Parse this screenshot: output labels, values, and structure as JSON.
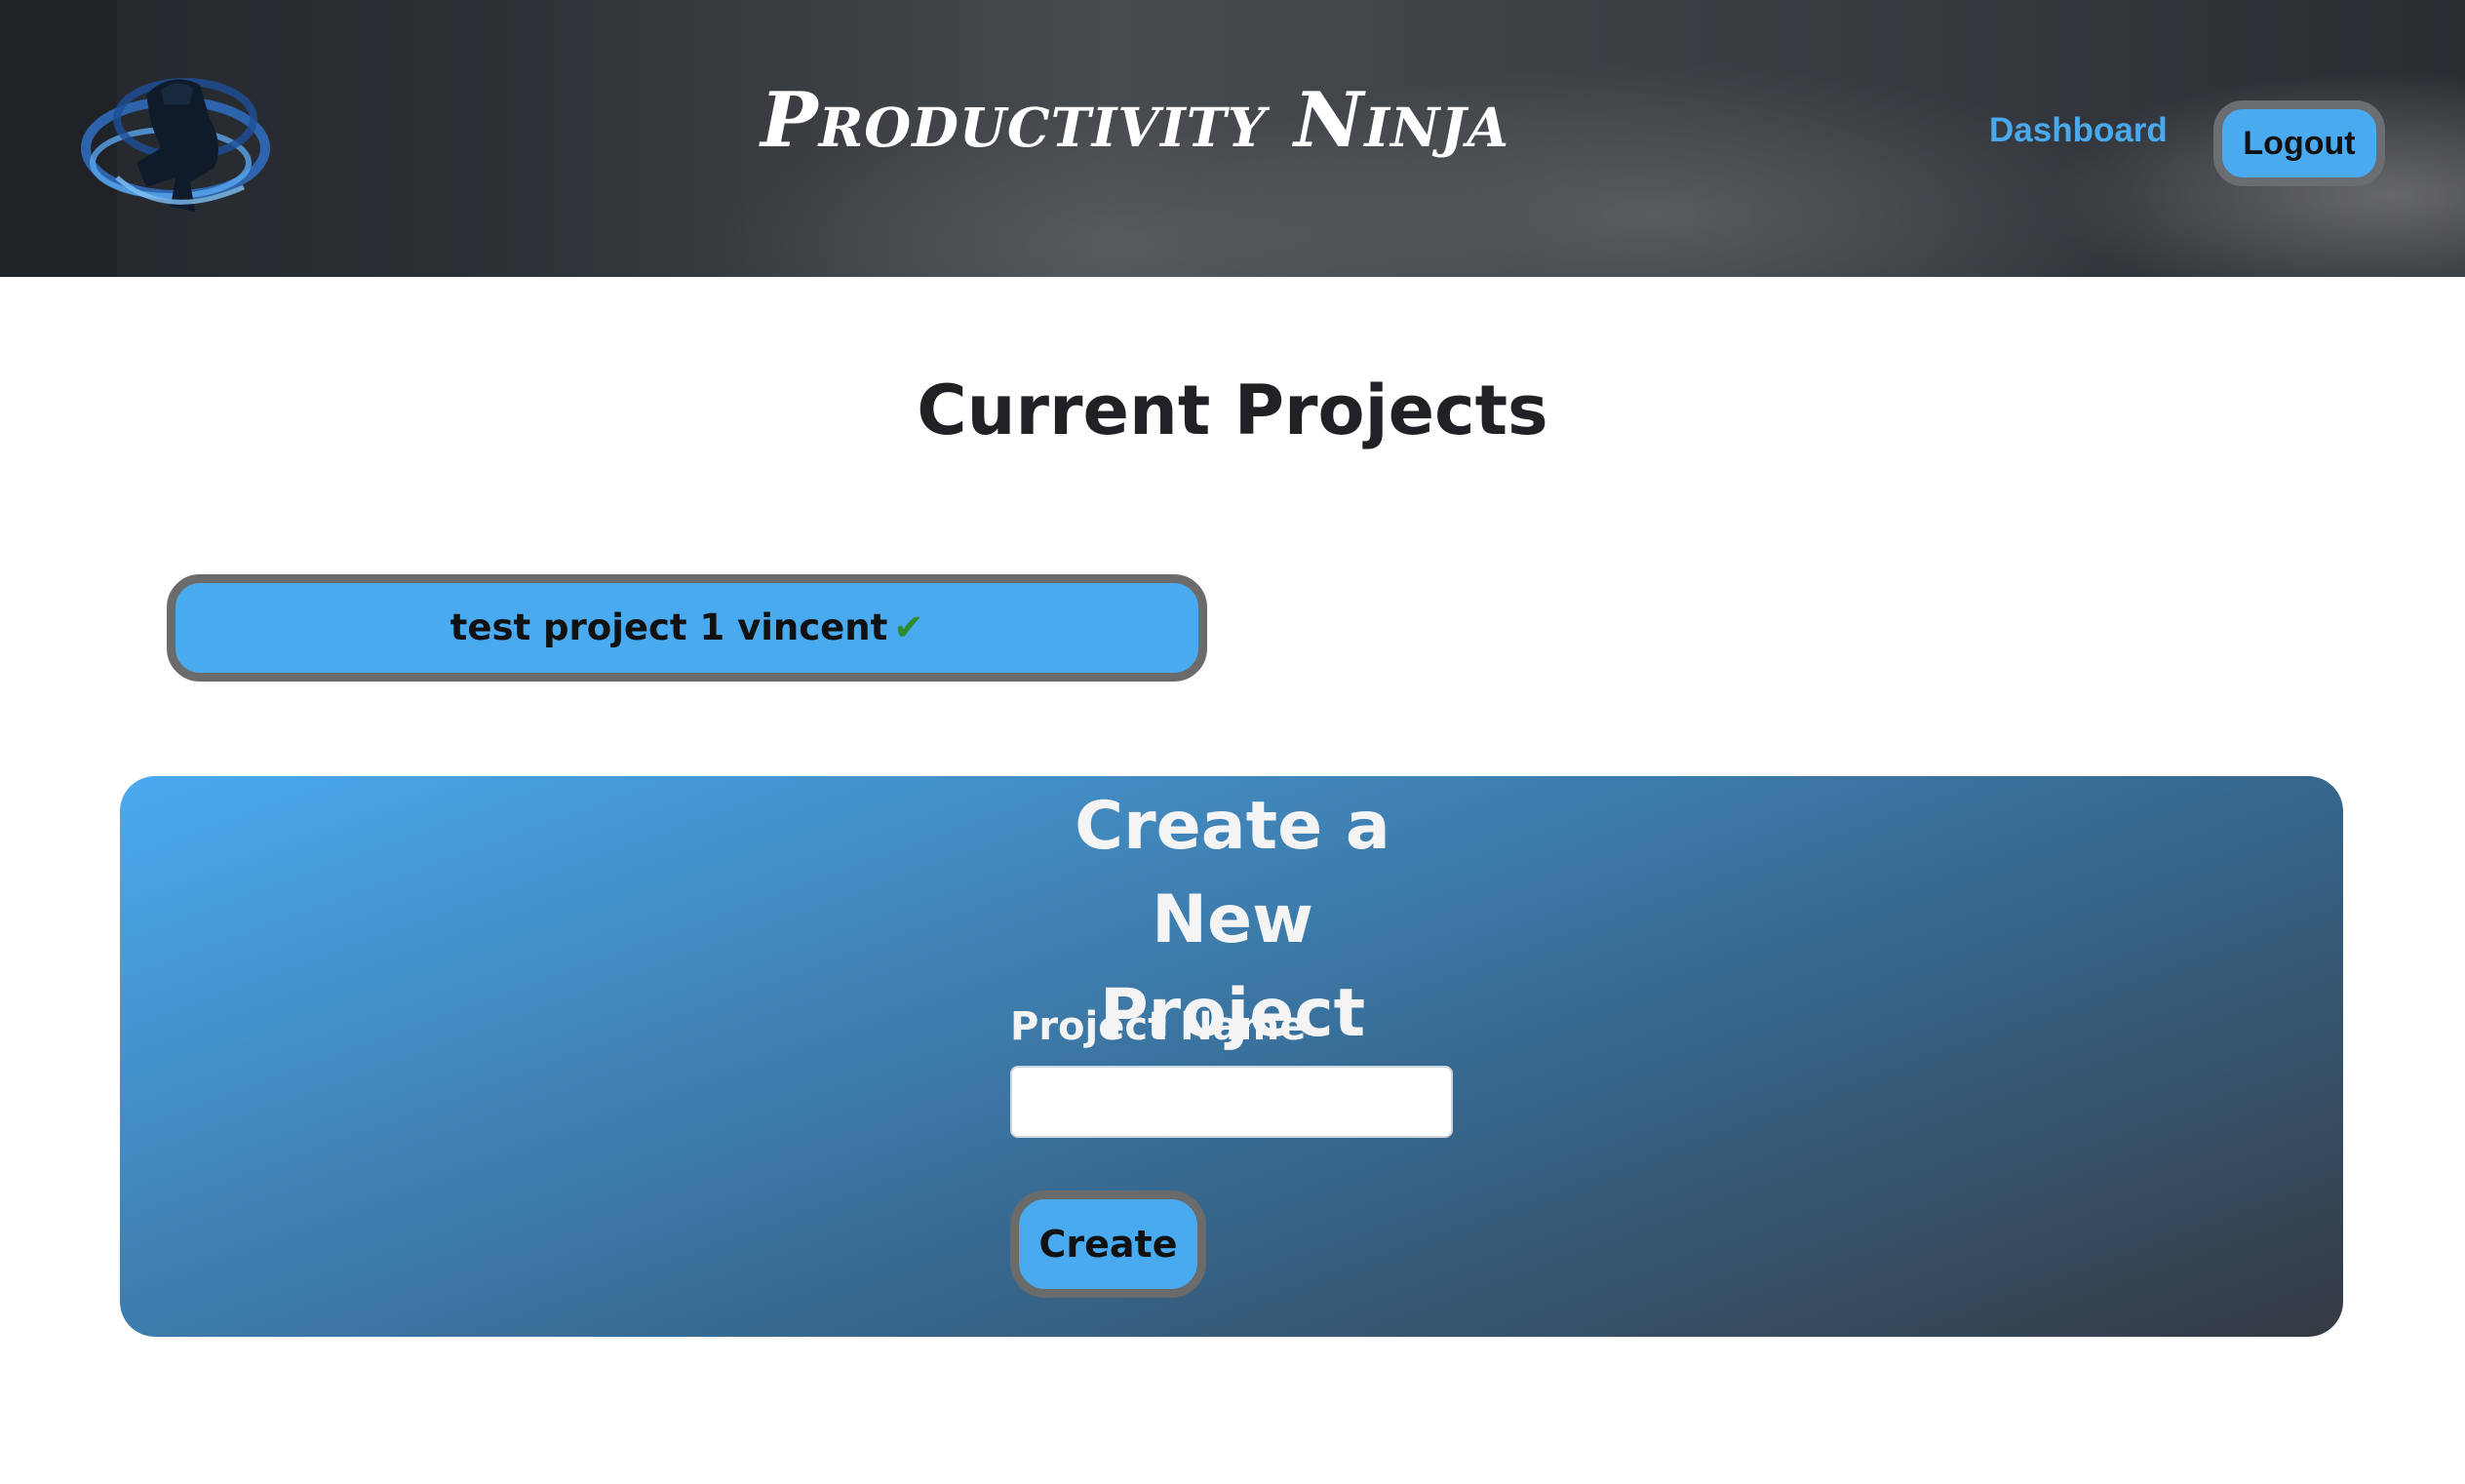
{
  "header": {
    "brand": "Productivity Ninja",
    "nav": {
      "dashboard_label": "Dashboard",
      "logout_label": "Logout"
    },
    "logo_icon": "ninja-logo-icon"
  },
  "main": {
    "title": "Current Projects",
    "projects": [
      {
        "name": "test project 1 vincent",
        "status_icon": "✔"
      }
    ]
  },
  "create_form": {
    "title": "Create a New Project",
    "field_label": "Project Name",
    "field_value": "",
    "submit_label": "Create"
  },
  "colors": {
    "accent": "#4aaaf0",
    "nav_link": "#4aa8ed",
    "check": "#2e8b2e",
    "title_text": "#1f2125"
  }
}
